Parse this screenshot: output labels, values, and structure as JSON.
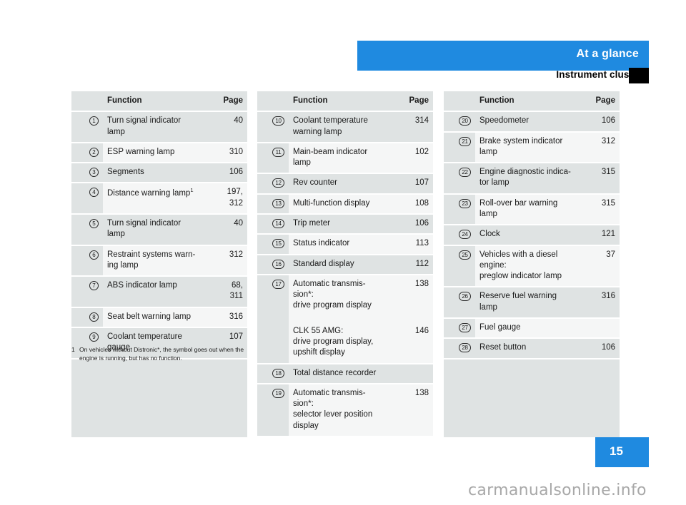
{
  "header": {
    "title": "At a glance",
    "subtitle": "Instrument cluster"
  },
  "columns": [
    {
      "head": {
        "function": "Function",
        "page": "Page"
      },
      "rows": [
        {
          "num": "1",
          "lines": [
            "Turn signal indicator",
            "lamp"
          ],
          "page": "40"
        },
        {
          "num": "2",
          "lines": [
            "ESP warning lamp"
          ],
          "page": "310"
        },
        {
          "num": "3",
          "lines": [
            "Segments"
          ],
          "page": "106"
        },
        {
          "num": "4",
          "lines": [
            "Distance warning lamp"
          ],
          "sup": "1",
          "page": "197,\n312"
        },
        {
          "num": "5",
          "lines": [
            "Turn signal indicator",
            "lamp"
          ],
          "page": "40"
        },
        {
          "num": "6",
          "lines": [
            "Restraint systems warn-",
            "ing lamp"
          ],
          "page": "312"
        },
        {
          "num": "7",
          "lines": [
            "ABS indicator lamp"
          ],
          "page": "68,\n311"
        },
        {
          "num": "8",
          "lines": [
            "Seat belt warning lamp"
          ],
          "page": "316"
        },
        {
          "num": "9",
          "lines": [
            "Coolant temperature",
            "gauge"
          ],
          "page": "107"
        }
      ]
    },
    {
      "head": {
        "function": "Function",
        "page": "Page"
      },
      "rows": [
        {
          "num": "10",
          "lines": [
            "Coolant temperature",
            "warning lamp"
          ],
          "page": "314"
        },
        {
          "num": "11",
          "lines": [
            "Main-beam indicator",
            "lamp"
          ],
          "page": "102"
        },
        {
          "num": "12",
          "lines": [
            "Rev counter"
          ],
          "page": "107"
        },
        {
          "num": "13",
          "lines": [
            "Multi-function display"
          ],
          "page": "108"
        },
        {
          "num": "14",
          "lines": [
            "Trip meter"
          ],
          "page": "106"
        },
        {
          "num": "15",
          "lines": [
            "Status indicator"
          ],
          "page": "113"
        },
        {
          "num": "16",
          "lines": [
            "Standard display"
          ],
          "page": "112"
        },
        {
          "num": "17",
          "lines": [
            "Automatic transmis-",
            "sion*:",
            "drive program display"
          ],
          "page": "138",
          "extra": {
            "lines": [
              "CLK 55 AMG:",
              "drive program display,",
              "upshift display"
            ],
            "page": "146"
          }
        },
        {
          "num": "18",
          "lines": [
            "Total distance recorder"
          ],
          "page": ""
        },
        {
          "num": "19",
          "lines": [
            "Automatic transmis-",
            "sion*:",
            "selector lever position",
            "display"
          ],
          "page": "138"
        }
      ]
    },
    {
      "head": {
        "function": "Function",
        "page": "Page"
      },
      "rows": [
        {
          "num": "20",
          "lines": [
            "Speedometer"
          ],
          "page": "106"
        },
        {
          "num": "21",
          "lines": [
            "Brake system indicator",
            "lamp"
          ],
          "page": "312"
        },
        {
          "num": "22",
          "lines": [
            "Engine diagnostic indica-",
            "tor lamp"
          ],
          "page": "315"
        },
        {
          "num": "23",
          "lines": [
            "Roll-over bar warning",
            "lamp"
          ],
          "page": "315"
        },
        {
          "num": "24",
          "lines": [
            "Clock"
          ],
          "page": "121"
        },
        {
          "num": "25",
          "lines": [
            "Vehicles with a diesel",
            "engine:",
            "preglow indicator lamp"
          ],
          "page": "37"
        },
        {
          "num": "26",
          "lines": [
            "Reserve fuel warning",
            "lamp"
          ],
          "page": "316"
        },
        {
          "num": "27",
          "lines": [
            "Fuel gauge"
          ],
          "page": ""
        },
        {
          "num": "28",
          "lines": [
            "Reset button"
          ],
          "page": "106"
        }
      ]
    }
  ],
  "footnote": {
    "mark": "1",
    "text": "On vehicles without Distronic*, the symbol goes out when the engine is running, but has no function."
  },
  "page_number": "15",
  "watermark": "carmanualsonline.info",
  "colors": {
    "accent_blue": "#1f8ae0",
    "row_gray": "#dfe3e3",
    "row_light": "#f5f6f6",
    "black_box": "#000000"
  }
}
